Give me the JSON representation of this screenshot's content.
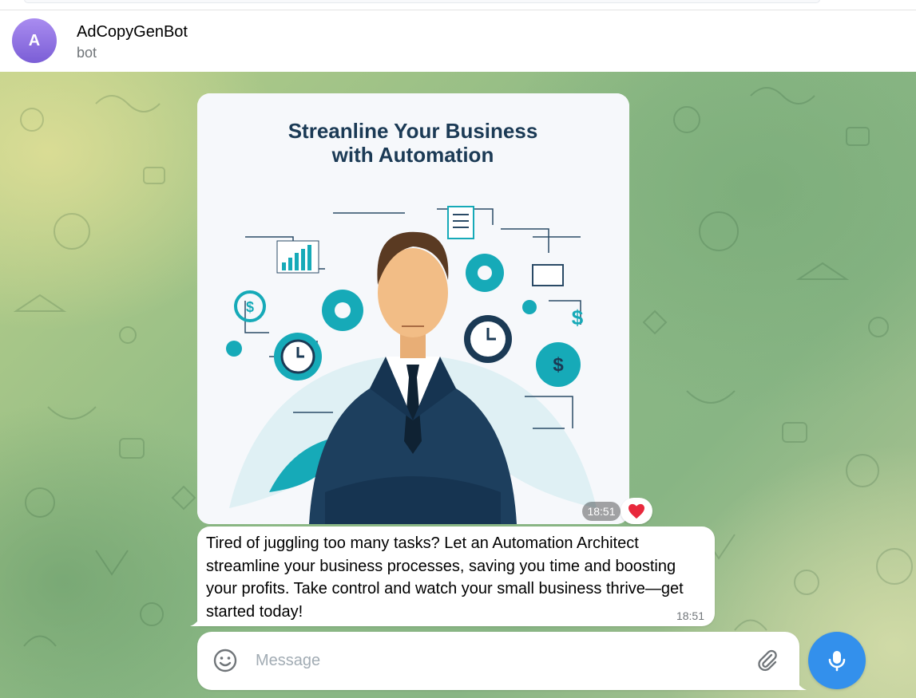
{
  "chat": {
    "avatar_letter": "A",
    "title": "AdCopyGenBot",
    "subtitle": "bot"
  },
  "media_message": {
    "image_title_line1": "Streanline Your Business",
    "image_title_line2": "with Automation",
    "time": "18:51",
    "reaction": "❤️"
  },
  "text_message": {
    "text": "Tired of juggling too many tasks? Let an Automation Architect streamline your business processes, saving you time and boosting your profits. Take control and watch your small business thrive—get started today!",
    "time": "18:51"
  },
  "composer": {
    "placeholder": "Message"
  },
  "colors": {
    "accent": "#3390ec",
    "avatar": "#8a6fe0",
    "teal": "#17b3bf",
    "navy": "#1d3f5e"
  },
  "icons": [
    "smile-icon",
    "paperclip-icon",
    "microphone-icon",
    "heart-icon"
  ]
}
